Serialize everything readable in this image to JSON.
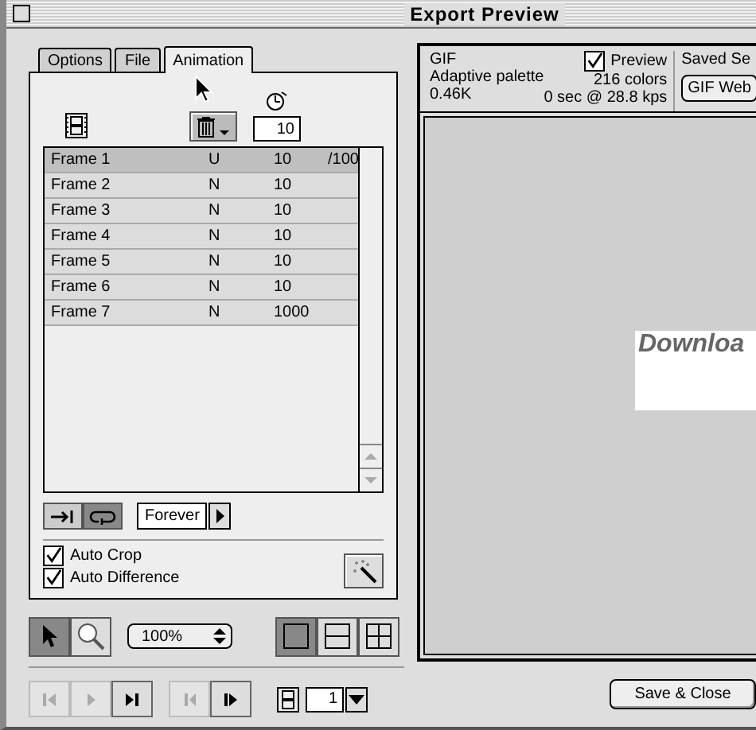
{
  "window": {
    "title": "Export Preview"
  },
  "tabs": [
    {
      "label": "Options",
      "selected": false
    },
    {
      "label": "File",
      "selected": false
    },
    {
      "label": "Animation",
      "selected": true
    }
  ],
  "animation": {
    "delay": "10",
    "frames": [
      {
        "name": "Frame 1",
        "disposal": "U",
        "delay": "10",
        "delay_unit": "/100",
        "selected": true
      },
      {
        "name": "Frame 2",
        "disposal": "N",
        "delay": "10",
        "selected": false
      },
      {
        "name": "Frame 3",
        "disposal": "N",
        "delay": "10",
        "selected": false
      },
      {
        "name": "Frame 4",
        "disposal": "N",
        "delay": "10",
        "selected": false
      },
      {
        "name": "Frame 5",
        "disposal": "N",
        "delay": "10",
        "selected": false
      },
      {
        "name": "Frame 6",
        "disposal": "N",
        "delay": "10",
        "selected": false
      },
      {
        "name": "Frame 7",
        "disposal": "N",
        "delay": "1000",
        "selected": false
      }
    ],
    "play_modes": [
      {
        "kind": "once",
        "selected": false
      },
      {
        "kind": "loop",
        "selected": true
      }
    ],
    "loop_count": "Forever",
    "options": [
      {
        "label": "Auto Crop",
        "checked": true
      },
      {
        "label": "Auto Difference",
        "checked": true
      }
    ]
  },
  "tools": [
    {
      "kind": "pointer",
      "selected": true
    },
    {
      "kind": "zoom",
      "selected": false
    }
  ],
  "zoom_level": "100%",
  "views": [
    {
      "kind": "single",
      "selected": true
    },
    {
      "kind": "two",
      "selected": false
    },
    {
      "kind": "four",
      "selected": false
    }
  ],
  "playback": [
    {
      "kind": "first",
      "disabled": true
    },
    {
      "kind": "play",
      "disabled": true
    },
    {
      "kind": "last",
      "disabled": false
    },
    {
      "kind": "prev",
      "disabled": true
    },
    {
      "kind": "next",
      "disabled": false
    }
  ],
  "current_frame": "1",
  "preview": {
    "format": "GIF",
    "palette": "Adaptive palette",
    "size": "0.46K",
    "show_preview": true,
    "preview_label": "Preview",
    "colors": "216 colors",
    "download_time": "0 sec @ 28.8 kps",
    "saved_settings_label": "Saved Se",
    "saved_settings": "GIF Web",
    "image_text": "Downloa"
  },
  "buttons": [
    "Save & Close"
  ]
}
